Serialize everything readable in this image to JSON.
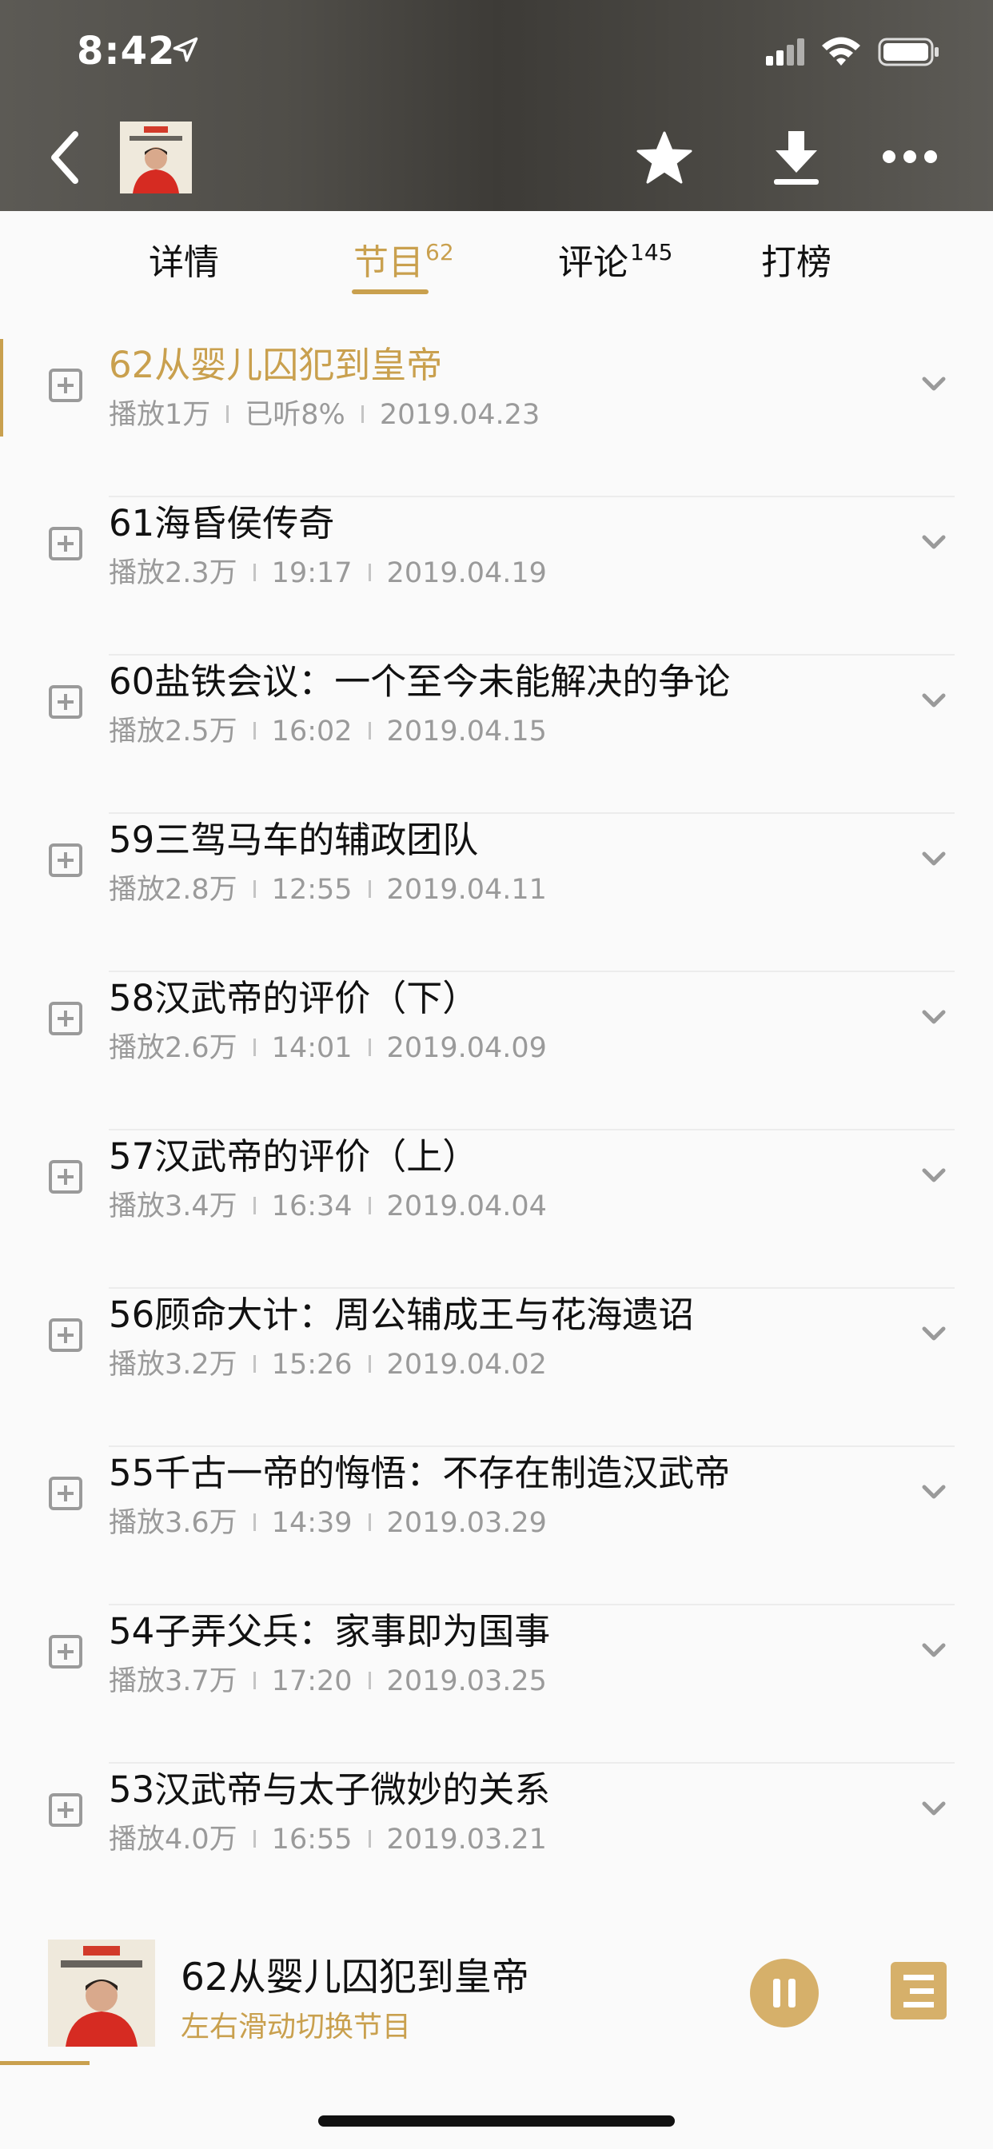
{
  "status_bar": {
    "time": "8:42"
  },
  "header": {
    "cover_alt": "album-cover"
  },
  "tabs": [
    {
      "label": "详情",
      "count": ""
    },
    {
      "label": "节目",
      "count": "62"
    },
    {
      "label": "评论",
      "count": "145"
    },
    {
      "label": "打榜",
      "count": ""
    }
  ],
  "episodes": [
    {
      "title": "62从婴儿囚犯到皇帝",
      "plays": "播放1万",
      "second": "已听8%",
      "date": "2019.04.23"
    },
    {
      "title": "61海昏侯传奇",
      "plays": "播放2.3万",
      "second": "19:17",
      "date": "2019.04.19"
    },
    {
      "title": "60盐铁会议：一个至今未能解决的争论",
      "plays": "播放2.5万",
      "second": "16:02",
      "date": "2019.04.15"
    },
    {
      "title": "59三驾马车的辅政团队",
      "plays": "播放2.8万",
      "second": "12:55",
      "date": "2019.04.11"
    },
    {
      "title": "58汉武帝的评价（下）",
      "plays": "播放2.6万",
      "second": "14:01",
      "date": "2019.04.09"
    },
    {
      "title": "57汉武帝的评价（上）",
      "plays": "播放3.4万",
      "second": "16:34",
      "date": "2019.04.04"
    },
    {
      "title": "56顾命大计：周公辅成王与花海遗诏",
      "plays": "播放3.2万",
      "second": "15:26",
      "date": "2019.04.02"
    },
    {
      "title": "55千古一帝的悔悟：不存在制造汉武帝",
      "plays": "播放3.6万",
      "second": "14:39",
      "date": "2019.03.29"
    },
    {
      "title": "54子弄父兵：家事即为国事",
      "plays": "播放3.7万",
      "second": "17:20",
      "date": "2019.03.25"
    },
    {
      "title": "53汉武帝与太子微妙的关系",
      "plays": "播放4.0万",
      "second": "16:55",
      "date": "2019.03.21"
    }
  ],
  "player": {
    "title": "62从婴儿囚犯到皇帝",
    "subtitle": "左右滑动切换节目"
  },
  "colors": {
    "accent": "#c9a04e",
    "header_bg": "#4f4d48",
    "text": "#111111",
    "meta": "#9a9a9a"
  }
}
